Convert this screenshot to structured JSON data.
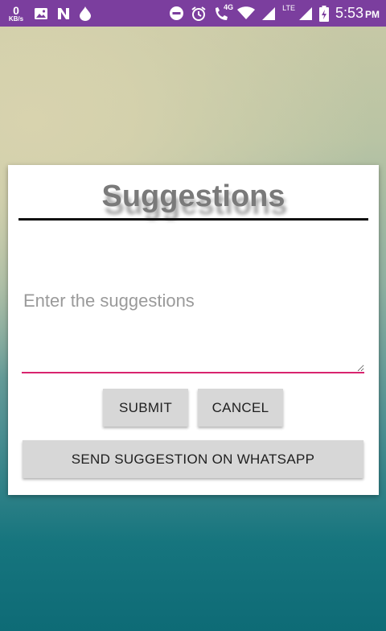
{
  "status_bar": {
    "net_speed_value": "0",
    "net_speed_unit": "KB/s",
    "network_type": "4G",
    "lte_label": "LTE",
    "time": "5:53",
    "ampm": "PM",
    "bg_color": "#7b3e9e"
  },
  "dialog": {
    "title": "Suggestions",
    "input_placeholder": "Enter the suggestions",
    "input_value": "",
    "underline_color": "#d8246f",
    "submit_label": "SUBMIT",
    "cancel_label": "CANCEL",
    "whatsapp_label": "SEND SUGGESTION ON WHATSAPP"
  },
  "icons": [
    "image-icon",
    "n-notification-icon",
    "drop-icon",
    "do-not-disturb-icon",
    "alarm-icon",
    "wifi-call-icon",
    "wifi-icon",
    "signal-icon",
    "signal-icon-2",
    "battery-icon"
  ]
}
